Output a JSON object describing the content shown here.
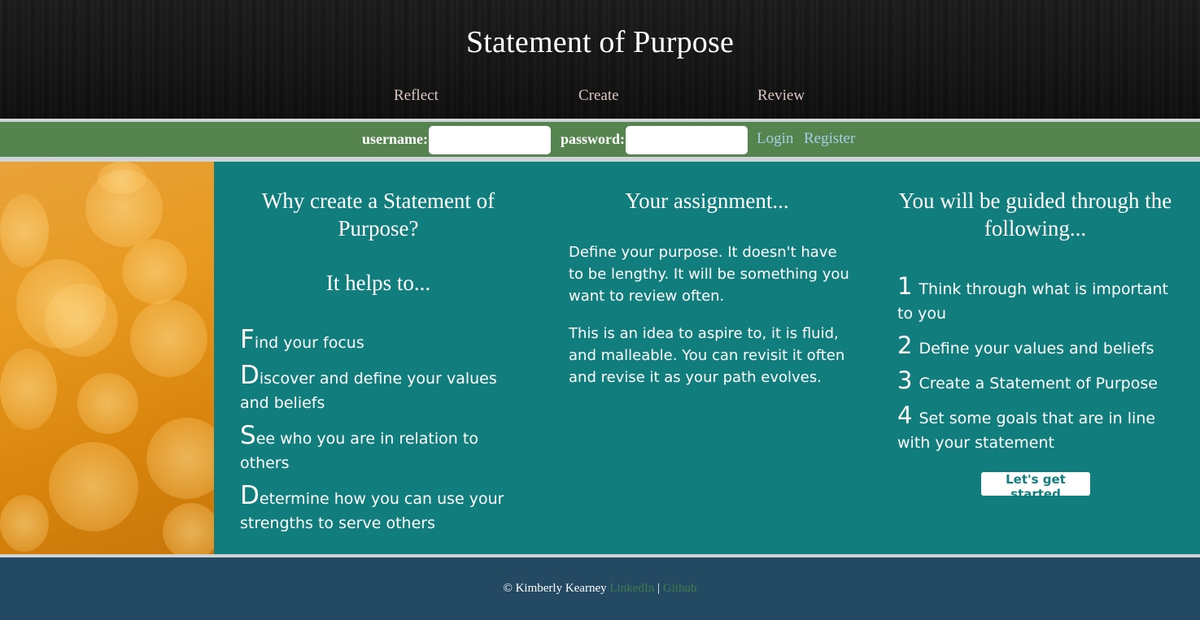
{
  "header": {
    "title": "Statement of Purpose",
    "nav": [
      "Reflect",
      "Create",
      "Review"
    ]
  },
  "login": {
    "username_label": "username:",
    "password_label": "password:",
    "username_value": "",
    "password_value": "",
    "login_label": "Login",
    "register_label": "Register"
  },
  "why": {
    "heading": "Why create a Statement of Purpose?",
    "subheading": "It helps to...",
    "items": [
      {
        "first": "F",
        "rest": "ind your focus"
      },
      {
        "first": "D",
        "rest": "iscover and define your values and beliefs"
      },
      {
        "first": "S",
        "rest": "ee who you are in relation to others"
      },
      {
        "first": "D",
        "rest": "etermine how you can use your strengths to serve others"
      }
    ]
  },
  "assignment": {
    "heading": "Your assignment...",
    "paragraphs": [
      "Define your purpose. It doesn't have to be lengthy. It will be something you want to review often.",
      "This is an idea to aspire to, it is fluid, and malleable. You can revisit it often and revise it as your path evolves."
    ]
  },
  "guided": {
    "heading": "You will be guided through the following...",
    "steps": [
      {
        "num": "1",
        "text": "Think through what is important to you"
      },
      {
        "num": "2",
        "text": "Define your values and beliefs"
      },
      {
        "num": "3",
        "text": "Create a Statement of Purpose"
      },
      {
        "num": "4",
        "text": "Set some goals that are in line with your statement"
      }
    ],
    "button_label": "Let's get started"
  },
  "footer": {
    "copyright": "© Kimberly Kearney",
    "linkedin": "LinkedIn",
    "separator": "|",
    "github": "Github"
  },
  "colors": {
    "header_bg": "#151515",
    "nav_text": "#d9c8c1",
    "login_bar": "#55844f",
    "login_link": "#a7cde3",
    "main_bg": "#117e7d",
    "footer_bg": "#244a63",
    "footer_link": "#44784b"
  }
}
